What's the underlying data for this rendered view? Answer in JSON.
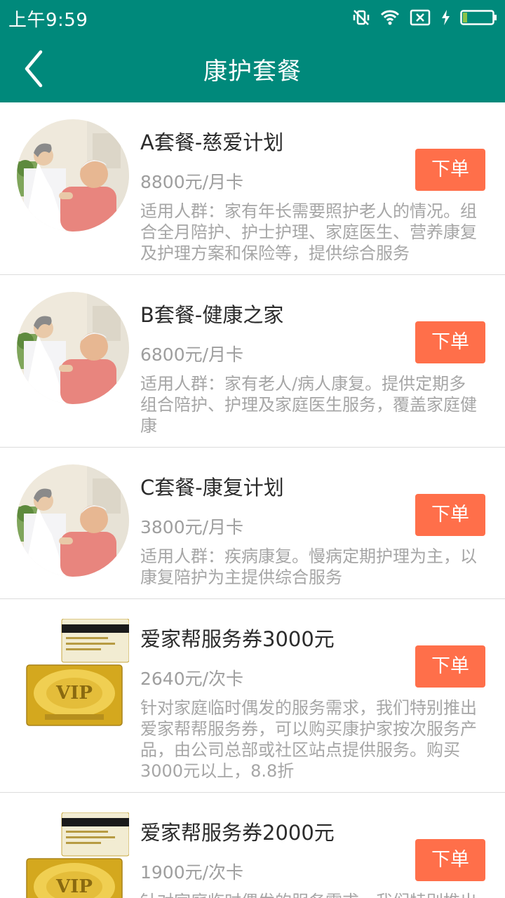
{
  "status_bar": {
    "time": "上午9:59",
    "icons": [
      "vibrate-off-icon",
      "wifi-icon",
      "no-sim-icon",
      "charging-icon",
      "battery-icon"
    ]
  },
  "nav": {
    "title": "康护套餐",
    "back_icon": "chevron-left-icon"
  },
  "colors": {
    "primary": "#00897b",
    "order_button": "#ff6f4a",
    "title_text": "#2b2b2b",
    "muted_text": "#9e9e9e"
  },
  "packages": [
    {
      "title": "A套餐-慈爱计划",
      "price": "8800元/月卡",
      "desc": "适用人群：家有年长需要照护老人的情况。组\n合全月陪护、护士护理、家庭医生、营养康复\n及护理方案和保险等，提供综合服务",
      "button": "下单",
      "image": "nurse-with-elderly-man-photo"
    },
    {
      "title": "B套餐-健康之家",
      "price": "6800元/月卡",
      "desc": "适用人群：家有老人/病人康复。提供定期多\n组合陪护、护理及家庭医生服务，覆盖家庭健\n康",
      "button": "下单",
      "image": "nurse-with-elderly-man-photo"
    },
    {
      "title": "C套餐-康复计划",
      "price": "3800元/月卡",
      "desc": "适用人群：疾病康复。慢病定期护理为主，以\n康复陪护为主提供综合服务",
      "button": "下单",
      "image": "nurse-with-elderly-man-photo"
    },
    {
      "title": "爱家帮服务券3000元",
      "price": "2640元/次卡",
      "desc": "针对家庭临时偶发的服务需求，我们特别推出\n爱家帮帮服务券，可以购买康护家按次服务产\n品，由公司总部或社区站点提供服务。购买\n3000元以上，8.8折",
      "button": "下单",
      "image": "vip-gold-card-image",
      "card_text": "VIP"
    },
    {
      "title": "爱家帮服务券2000元",
      "price": "1900元/次卡",
      "desc": "针对家庭临时偶发的服务需求，我们特别推出",
      "button": "下单",
      "image": "vip-gold-card-image",
      "card_text": "VIP"
    }
  ]
}
